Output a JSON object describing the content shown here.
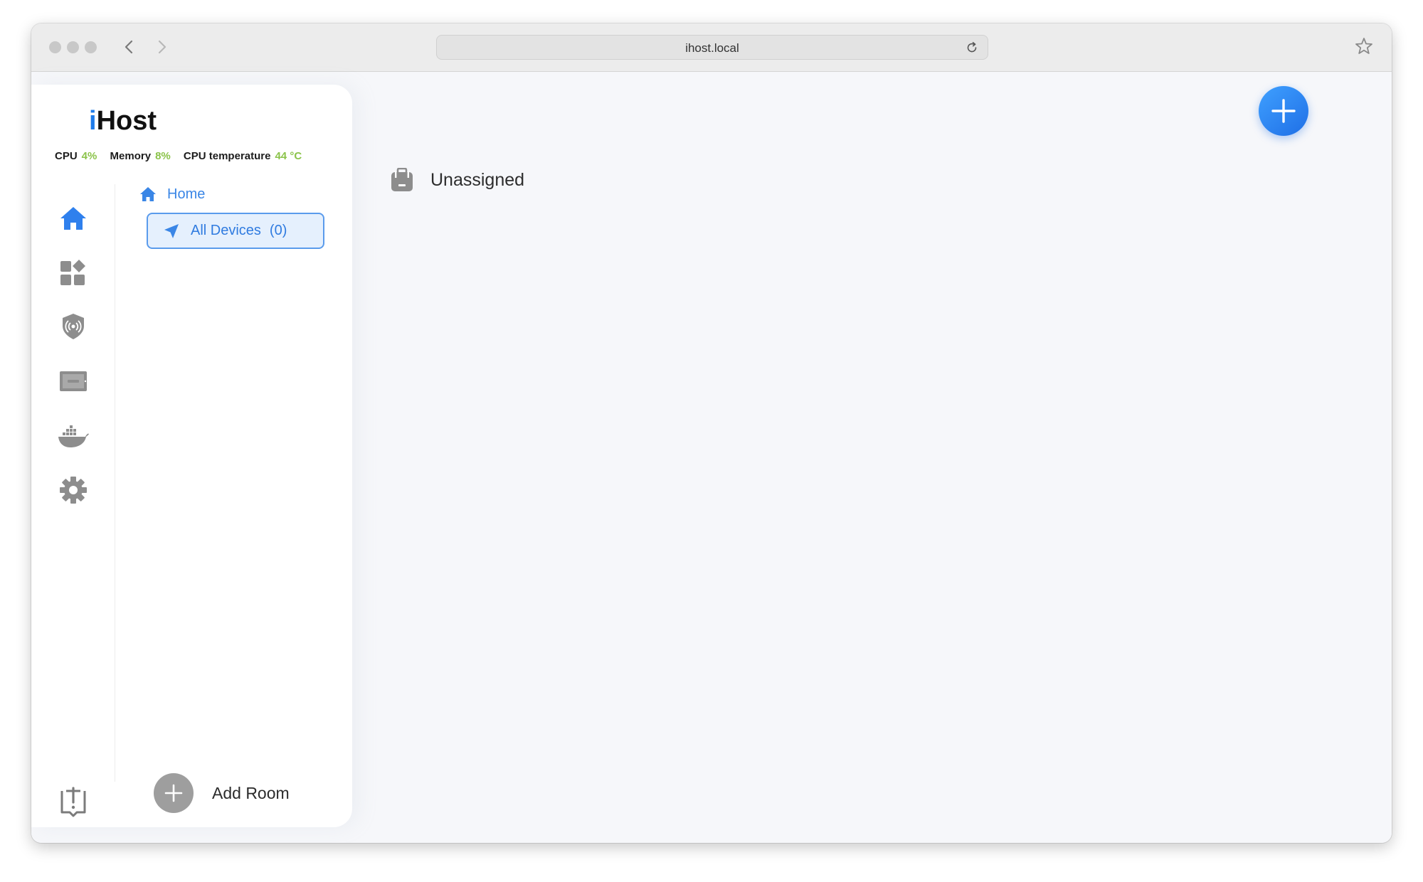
{
  "browser": {
    "url": "ihost.local"
  },
  "app": {
    "logo_prefix": "i",
    "logo_rest": "Host",
    "accent_color": "#1e7bea",
    "stat_value_color": "#8bc34a"
  },
  "stats": [
    {
      "label": "CPU",
      "value": "4%"
    },
    {
      "label": "Memory",
      "value": "8%"
    },
    {
      "label": "CPU temperature",
      "value": "44 °C"
    }
  ],
  "rail": {
    "items": [
      {
        "icon": "home-icon",
        "active": true
      },
      {
        "icon": "apps-icon",
        "active": false
      },
      {
        "icon": "security-shield-icon",
        "active": false
      },
      {
        "icon": "display-panel-icon",
        "active": false
      },
      {
        "icon": "docker-icon",
        "active": false
      },
      {
        "icon": "settings-gear-icon",
        "active": false
      }
    ],
    "bottom_icon": "feedback-icon"
  },
  "rooms": {
    "home_label": "Home",
    "all_devices_label": "All Devices",
    "all_devices_count": "(0)",
    "add_room_label": "Add Room"
  },
  "main": {
    "section_title": "Unassigned"
  }
}
